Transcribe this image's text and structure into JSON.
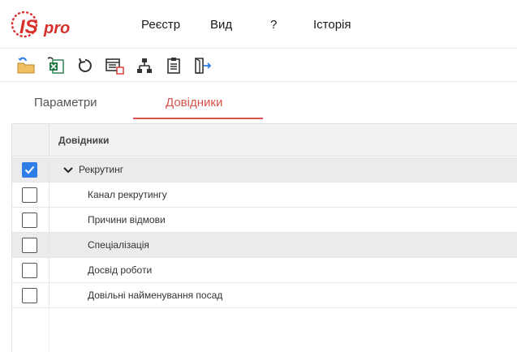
{
  "app": {
    "logo_text": "IS-pro"
  },
  "menu": [
    {
      "label": "Реєстр"
    },
    {
      "label": "Вид"
    },
    {
      "label": "?"
    },
    {
      "label": "Історія"
    }
  ],
  "toolbar": [
    {
      "icon": "folder-import-icon"
    },
    {
      "icon": "excel-export-icon"
    },
    {
      "icon": "refresh-icon"
    },
    {
      "icon": "settings-table-icon"
    },
    {
      "icon": "hierarchy-icon"
    },
    {
      "icon": "clipboard-list-icon"
    },
    {
      "icon": "exit-icon"
    }
  ],
  "tabs": [
    {
      "label": "Параметри",
      "active": false
    },
    {
      "label": "Довідники",
      "active": true
    }
  ],
  "colors": {
    "accent": "#d9534f",
    "checkbox_checked": "#2f7ee8"
  },
  "table": {
    "header": "Довідники",
    "rows": [
      {
        "label": "Рекрутинг",
        "checked": true,
        "expanded": true,
        "level": 0
      },
      {
        "label": "Канал рекрутингу",
        "checked": false,
        "level": 1
      },
      {
        "label": "Причини відмови",
        "checked": false,
        "level": 1
      },
      {
        "label": "Спеціалізація",
        "checked": false,
        "level": 1
      },
      {
        "label": "Досвід роботи",
        "checked": false,
        "level": 1
      },
      {
        "label": "Довільні найменування посад",
        "checked": false,
        "level": 1
      }
    ]
  }
}
